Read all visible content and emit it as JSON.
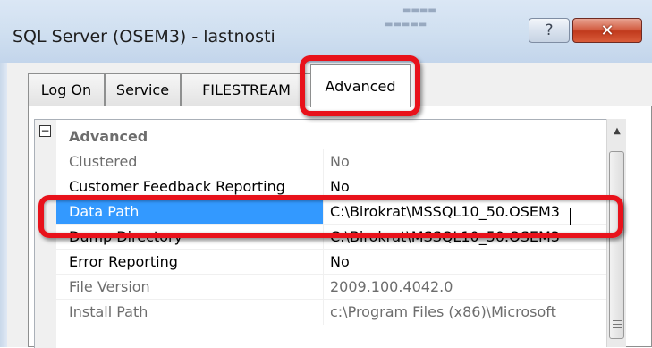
{
  "window": {
    "title": "SQL Server (OSEM3) - lastnosti",
    "help_glyph": "?",
    "close_glyph": "✕"
  },
  "tabs": [
    {
      "label": "Log On",
      "active": false
    },
    {
      "label": "Service",
      "active": false
    },
    {
      "label": "FILESTREAM",
      "active": false
    },
    {
      "label": "Advanced",
      "active": true
    }
  ],
  "grid": {
    "collapse_glyph": "−",
    "category": "Advanced",
    "rows": [
      {
        "name": "Clustered",
        "value": "No",
        "readonly": true
      },
      {
        "name": "Customer Feedback Reporting",
        "value": "No",
        "readonly": false
      },
      {
        "name": "Data Path",
        "value": "C:\\Birokrat\\MSSQL10_50.OSEM3",
        "readonly": false,
        "selected": true
      },
      {
        "name": "Dump Directory",
        "value": "C:\\Birokrat\\MSSQL10_50.OSEM3",
        "readonly": false
      },
      {
        "name": "Error Reporting",
        "value": "No",
        "readonly": false
      },
      {
        "name": "File Version",
        "value": "2009.100.4042.0",
        "readonly": true
      },
      {
        "name": "Install Path",
        "value": "c:\\Program Files (x86)\\Microsoft",
        "readonly": true
      }
    ]
  },
  "scrollbar": {
    "up_glyph": "▲"
  },
  "colors": {
    "highlight_red": "#e8121b",
    "selection_blue": "#3399ff"
  }
}
